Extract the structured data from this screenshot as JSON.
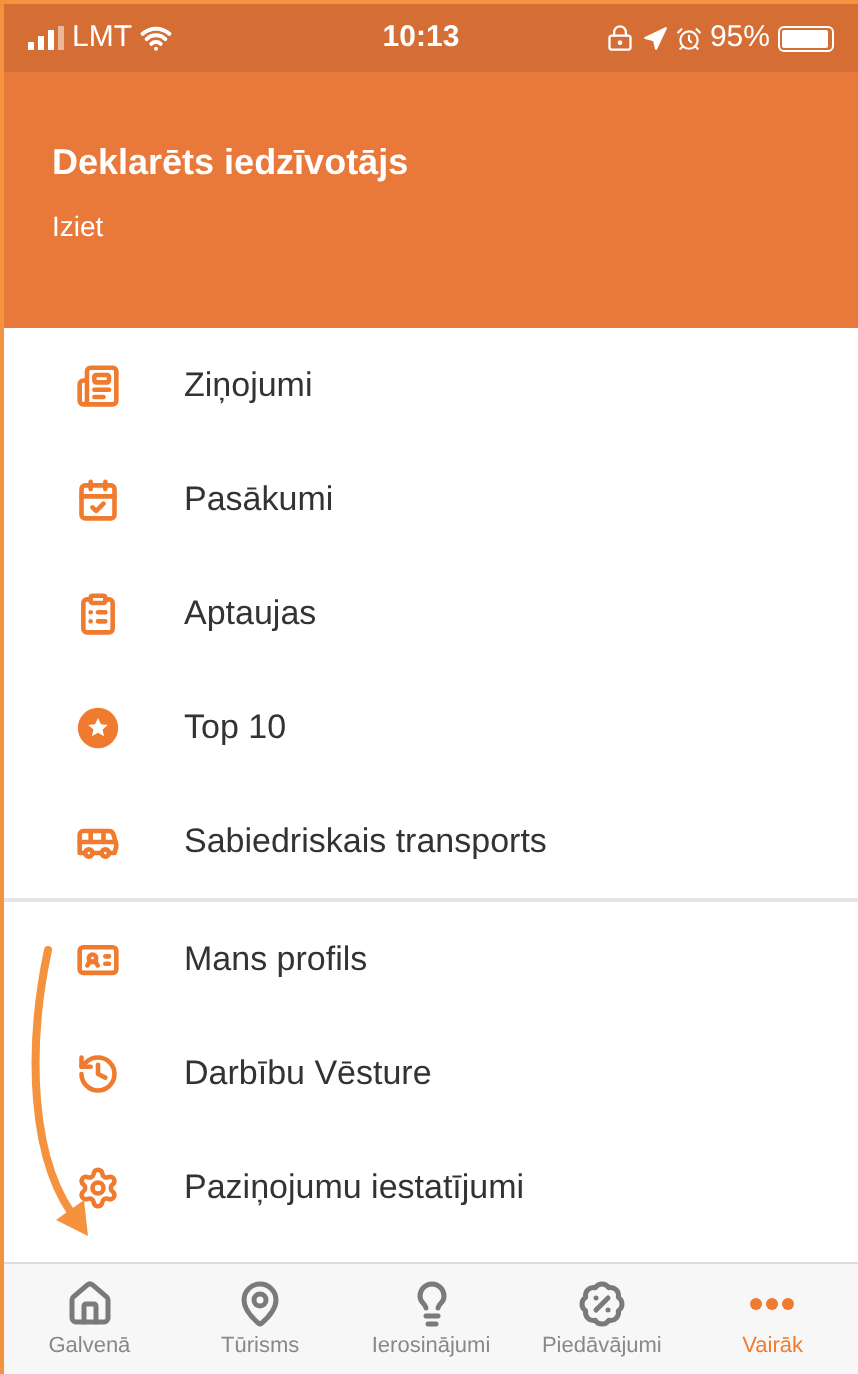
{
  "status_bar": {
    "carrier": "LMT",
    "time": "10:13",
    "battery": "95%"
  },
  "header": {
    "title": "Deklarēts iedzīvotājs",
    "link": "Iziet"
  },
  "menu": {
    "sections": [
      {
        "items": [
          "Ziņojumi",
          "Pasākumi",
          "Aptaujas",
          "Top 10",
          "Sabiedriskais transports"
        ]
      },
      {
        "items": [
          "Mans profils",
          "Darbību Vēsture",
          "Paziņojumu iestatījumi"
        ]
      }
    ]
  },
  "tab_bar": [
    {
      "label": "Galvenā",
      "selected": false
    },
    {
      "label": "Tūrisms",
      "selected": false
    },
    {
      "label": "Ierosinājumi",
      "selected": false
    },
    {
      "label": "Piedāvājumi",
      "selected": false
    },
    {
      "label": "Vairāk",
      "selected": true
    }
  ]
}
